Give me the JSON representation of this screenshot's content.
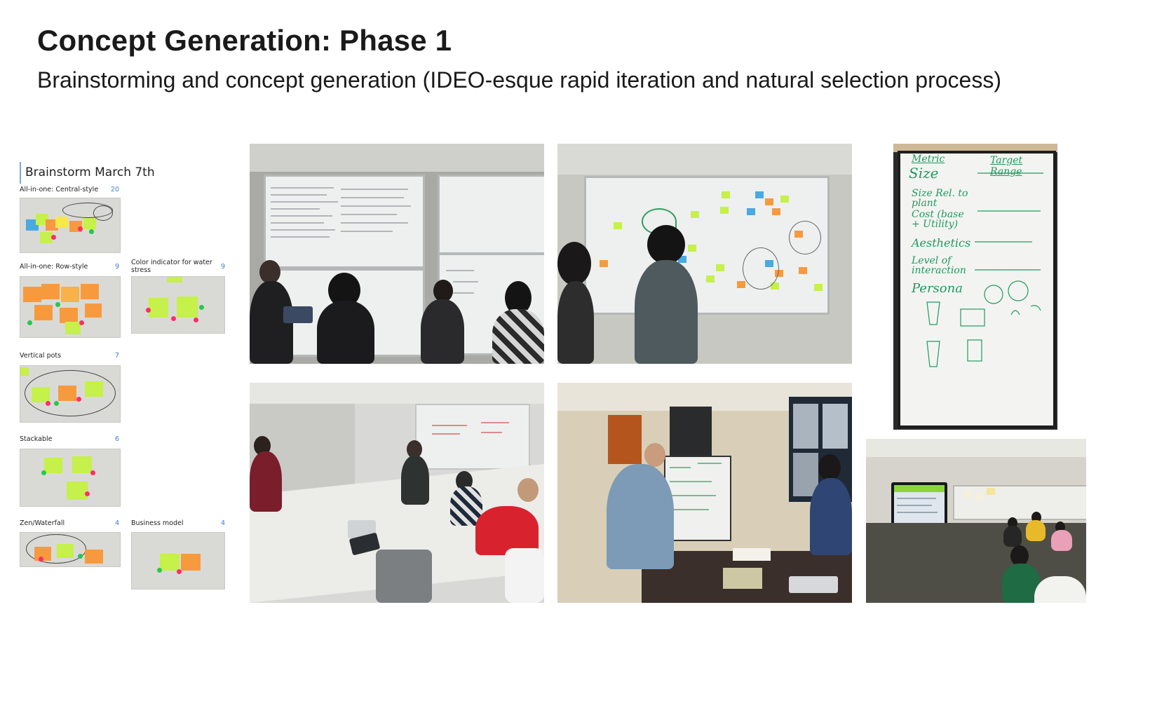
{
  "header": {
    "title": "Concept Generation: Phase 1",
    "subtitle": "Brainstorming and concept generation (IDEO-esque rapid iteration and natural selection process)"
  },
  "board": {
    "title": "Brainstorm March 7th",
    "groups": [
      {
        "label": "All-in-one: Central-style",
        "count": "20"
      },
      {
        "label": "All-in-one: Row-style",
        "count": "9"
      },
      {
        "label": "Color indicator for water stress",
        "count": "9"
      },
      {
        "label": "Vertical pots",
        "count": "7"
      },
      {
        "label": "Stackable",
        "count": "6"
      },
      {
        "label": "Zen/Waterfall",
        "count": "4"
      },
      {
        "label": "Business model",
        "count": "4"
      }
    ]
  },
  "whiteboard_photo": {
    "metric_header": "Metric",
    "target_header": "Target Range",
    "rows": [
      "Size",
      "Size Rel. to plant",
      "Cost (base + Utility)",
      "Aesthetics",
      "Level of interaction",
      "Persona"
    ]
  },
  "colors": {
    "sticky_orange": "#f79a3e",
    "sticky_green": "#c6f04a",
    "sticky_blue": "#4aa9e0",
    "dot_pink": "#ff2d6a",
    "dot_green": "#27c74a",
    "count_blue": "#3f7fd1",
    "marker_green": "#1f9a5e"
  }
}
